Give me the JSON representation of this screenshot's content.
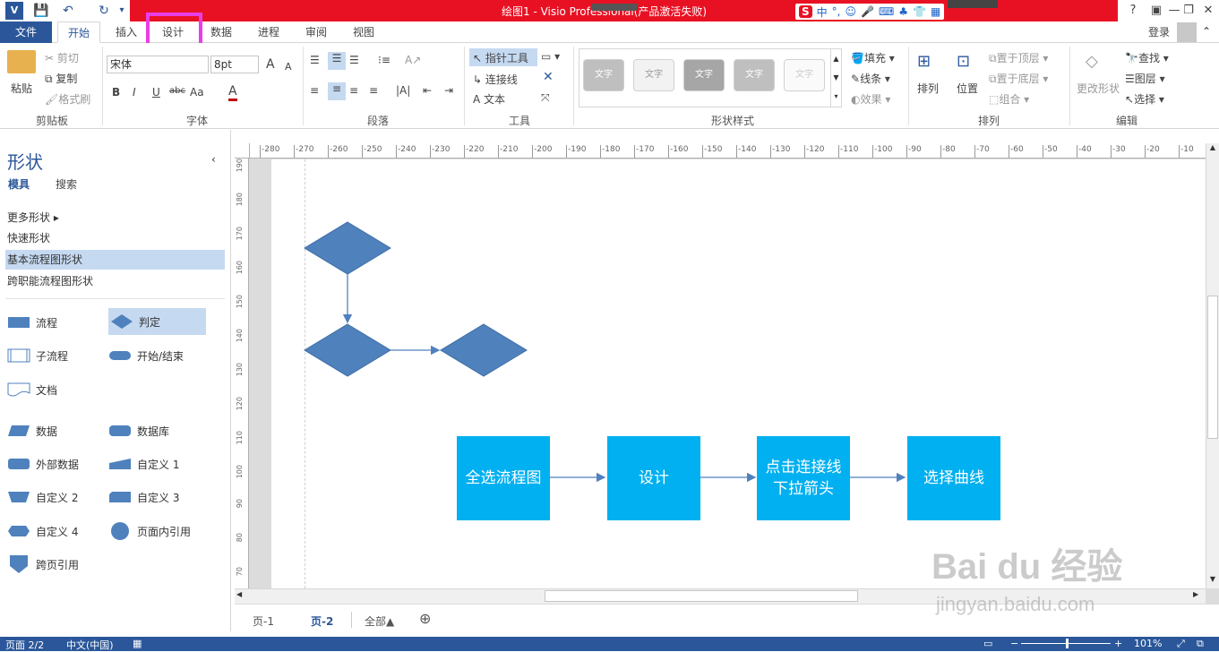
{
  "titlebar": {
    "title": "绘图1 -  Visio Professional(产品激活失败)",
    "help": "?",
    "minimize": "—",
    "restore": "❐",
    "close": "✕"
  },
  "ime": {
    "s": "S",
    "items": [
      "中",
      "°,",
      "☺",
      "🎤",
      "⌨",
      "♣",
      "👕",
      "▦"
    ]
  },
  "tabs": {
    "file": "文件",
    "items": [
      "开始",
      "插入",
      "设计",
      "数据",
      "进程",
      "审阅",
      "视图"
    ],
    "login": "登录"
  },
  "ribbon": {
    "clipboard": {
      "paste": "粘贴",
      "cut": "剪切",
      "copy": "复制",
      "format_painter": "格式刷",
      "label": "剪贴板"
    },
    "font": {
      "family": "宋体",
      "size": "8pt",
      "bold": "B",
      "italic": "I",
      "underline": "U",
      "strike": "abc",
      "case": "Aa",
      "color": "A",
      "label": "字体",
      "grow": "A",
      "shrink": "A"
    },
    "paragraph": {
      "label": "段落"
    },
    "tools": {
      "pointer": "指针工具",
      "connector": "连接线",
      "text": "文本",
      "label": "工具"
    },
    "shape_styles": {
      "swatch_text": "文字",
      "fill": "填充",
      "line": "线条",
      "effect": "效果",
      "label": "形状样式"
    },
    "arrange": {
      "arrange": "排列",
      "position": "位置",
      "bring_front": "置于顶层",
      "send_back": "置于底层",
      "group": "组合",
      "label": "排列"
    },
    "editing": {
      "change_shape": "更改形状",
      "find": "查找",
      "layers": "图层",
      "select": "选择",
      "label": "编辑"
    }
  },
  "shapes_panel": {
    "title": "形状",
    "tab_stencils": "模具",
    "tab_search": "搜索",
    "stencils": [
      "更多形状",
      "快速形状",
      "基本流程图形状",
      "跨职能流程图形状"
    ],
    "shapes": [
      "流程",
      "判定",
      "子流程",
      "开始/结束",
      "文档",
      "数据",
      "数据库",
      "外部数据",
      "自定义 1",
      "自定义 2",
      "自定义 3",
      "自定义 4",
      "页面内引用",
      "跨页引用"
    ]
  },
  "ruler": {
    "h_ticks": [
      "-280",
      "-270",
      "-260",
      "-250",
      "-240",
      "-230",
      "-220",
      "-210",
      "-200",
      "-190",
      "-180",
      "-170",
      "-160",
      "-150",
      "-140",
      "-130",
      "-120",
      "-110",
      "-100",
      "-90",
      "-80",
      "-70",
      "-60",
      "-50",
      "-40",
      "-30",
      "-20",
      "-10"
    ],
    "v_ticks": [
      "190",
      "180",
      "170",
      "160",
      "150",
      "140",
      "130",
      "120",
      "110",
      "100",
      "90",
      "80",
      "70"
    ]
  },
  "flow": {
    "boxes": [
      "全选流程图",
      "设计",
      "点击连接线下拉箭头",
      "选择曲线"
    ]
  },
  "page_tabs": {
    "p1": "页-1",
    "p2": "页-2",
    "all": "全部▲",
    "add": "⊕"
  },
  "status": {
    "page": "页面 2/2",
    "lang": "中文(中国)",
    "zoom": "101%"
  },
  "watermark": {
    "main": "Bai du 经验",
    "sub": "jingyan.baidu.com"
  },
  "colors": {
    "accent": "#2b579a",
    "title_red": "#e81123",
    "highlight": "#e83ee8",
    "shape_blue": "#4f81bd",
    "flow_box": "#00b0f0"
  }
}
